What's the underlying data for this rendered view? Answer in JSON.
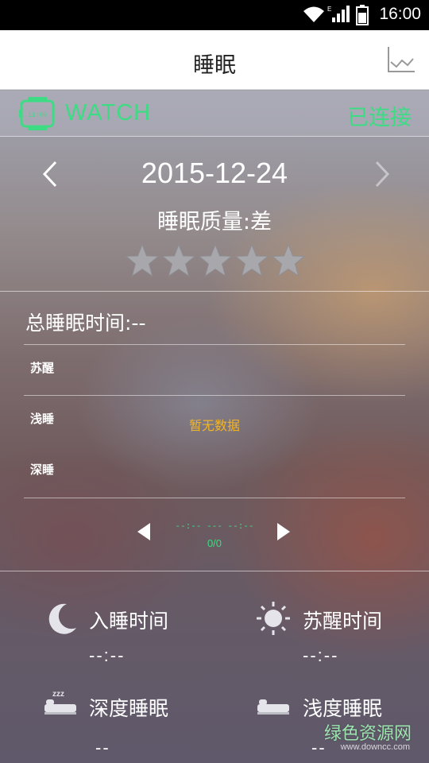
{
  "status_bar": {
    "time": "16:00"
  },
  "header": {
    "title": "睡眠",
    "chart_icon": "line-chart-icon"
  },
  "watch": {
    "label": "WATCH",
    "status": "已连接",
    "icon": "watch-icon",
    "icon_text": "11:09"
  },
  "date": {
    "value": "2015-12-24"
  },
  "quality": {
    "text": "睡眠质量:差",
    "stars_filled": 0,
    "stars_total": 5
  },
  "detail": {
    "total_sleep": "总睡眠时间:--",
    "rows": [
      "苏醒",
      "浅睡",
      "深睡"
    ],
    "no_data": "暂无数据",
    "range": "--:-- --- --:--",
    "page": "0/0"
  },
  "stats": {
    "sleep_time_label": "入睡时间",
    "sleep_time_value": "--:--",
    "wake_time_label": "苏醒时间",
    "wake_time_value": "--:--",
    "deep_sleep_label": "深度睡眠",
    "deep_sleep_value": "--",
    "light_sleep_label": "浅度睡眠",
    "light_sleep_value": "--"
  },
  "watermark": {
    "text": "绿色资源网",
    "url": "www.downcc.com"
  },
  "colors": {
    "accent_green": "#3ddc84",
    "no_data_orange": "#f0b429"
  }
}
